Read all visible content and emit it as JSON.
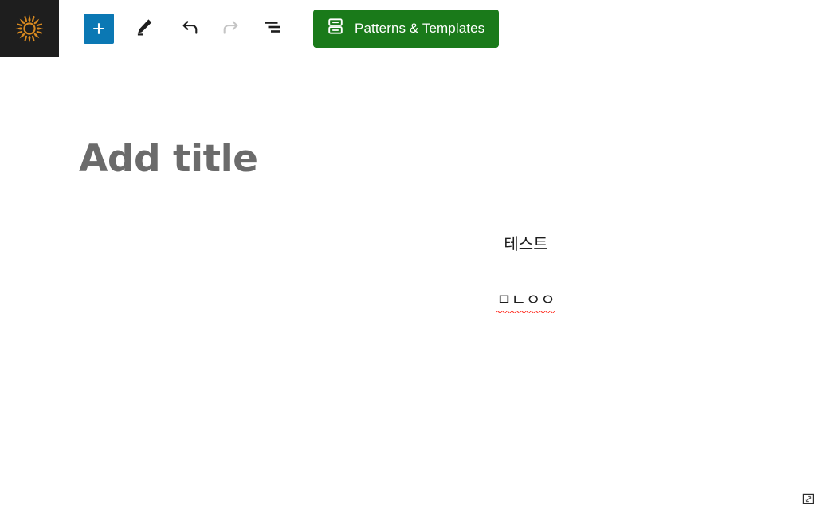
{
  "header": {
    "site_logo": {
      "icon": "sun-icon",
      "color": "#d98a20",
      "background": "#1e1e1e"
    },
    "toolbar": {
      "inserter": {
        "label": "Toggle block inserter",
        "icon": "plus-icon",
        "color": "#0b78b4"
      },
      "tools": {
        "label": "Tools",
        "icon": "pencil-icon"
      },
      "undo": {
        "label": "Undo",
        "icon": "undo-arrow-icon",
        "enabled": true
      },
      "redo": {
        "label": "Redo",
        "icon": "redo-arrow-icon",
        "enabled": false
      },
      "list_view": {
        "label": "Document Overview",
        "icon": "list-view-icon"
      }
    },
    "patterns_button": {
      "label": "Patterns & Templates",
      "icon": "stacked-blocks-icon",
      "color": "#1a7a1a",
      "text_color": "#ffffff"
    }
  },
  "editor": {
    "title": {
      "placeholder": "Add title",
      "value": "",
      "color": "#6b6b6b"
    },
    "blocks": [
      {
        "type": "paragraph",
        "text": "테스트",
        "align": "center",
        "spellcheck_error": false
      },
      {
        "type": "paragraph",
        "text": "ㅁㄴㅇㅇ",
        "align": "center",
        "spellcheck_error": true,
        "underline_color": "#ff3b30"
      }
    ]
  }
}
